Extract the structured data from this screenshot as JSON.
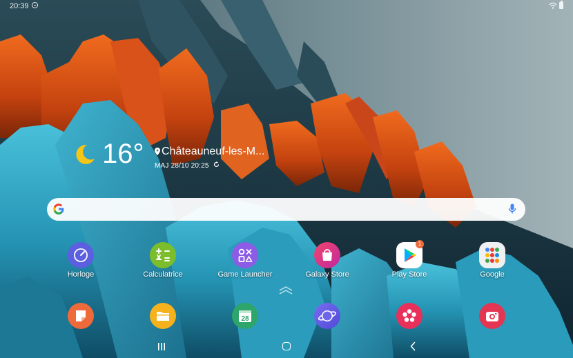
{
  "status_bar": {
    "time": "20:39"
  },
  "weather": {
    "temperature": "16°",
    "location": "Châteauneuf-les-M...",
    "updated": "MAJ 28/10 20:25"
  },
  "apps_row": [
    {
      "label": "Horloge",
      "icon": "clock-icon",
      "color": "#5b5fe0"
    },
    {
      "label": "Calculatrice",
      "icon": "calculator-icon",
      "color": "#7bbd2a"
    },
    {
      "label": "Game Launcher",
      "icon": "game-launcher-icon",
      "color": "#8c5ce6"
    },
    {
      "label": "Galaxy Store",
      "icon": "galaxy-store-icon",
      "color": "#e8366e"
    },
    {
      "label": "Play Store",
      "icon": "play-store-icon",
      "color": "#ffffff",
      "badge": "1"
    },
    {
      "label": "Google",
      "icon": "google-folder-icon",
      "color": "#eef0f2"
    }
  ],
  "dock": [
    {
      "icon": "samsung-notes-icon",
      "color": "#ef6a3a"
    },
    {
      "icon": "my-files-icon",
      "color": "#f5b21c"
    },
    {
      "icon": "calendar-icon",
      "color": "#2ea56b",
      "text": "28"
    },
    {
      "icon": "samsung-internet-icon",
      "color": "#6560e8"
    },
    {
      "icon": "gallery-icon",
      "color": "#e8305a"
    },
    {
      "icon": "camera-icon",
      "color": "#e43552"
    }
  ],
  "colors": {
    "sky": "#9aacb0",
    "orange_peaks": "#d24a12",
    "teal_waves": "#2fa6c4",
    "dark_ridges": "#1f3e4a"
  }
}
